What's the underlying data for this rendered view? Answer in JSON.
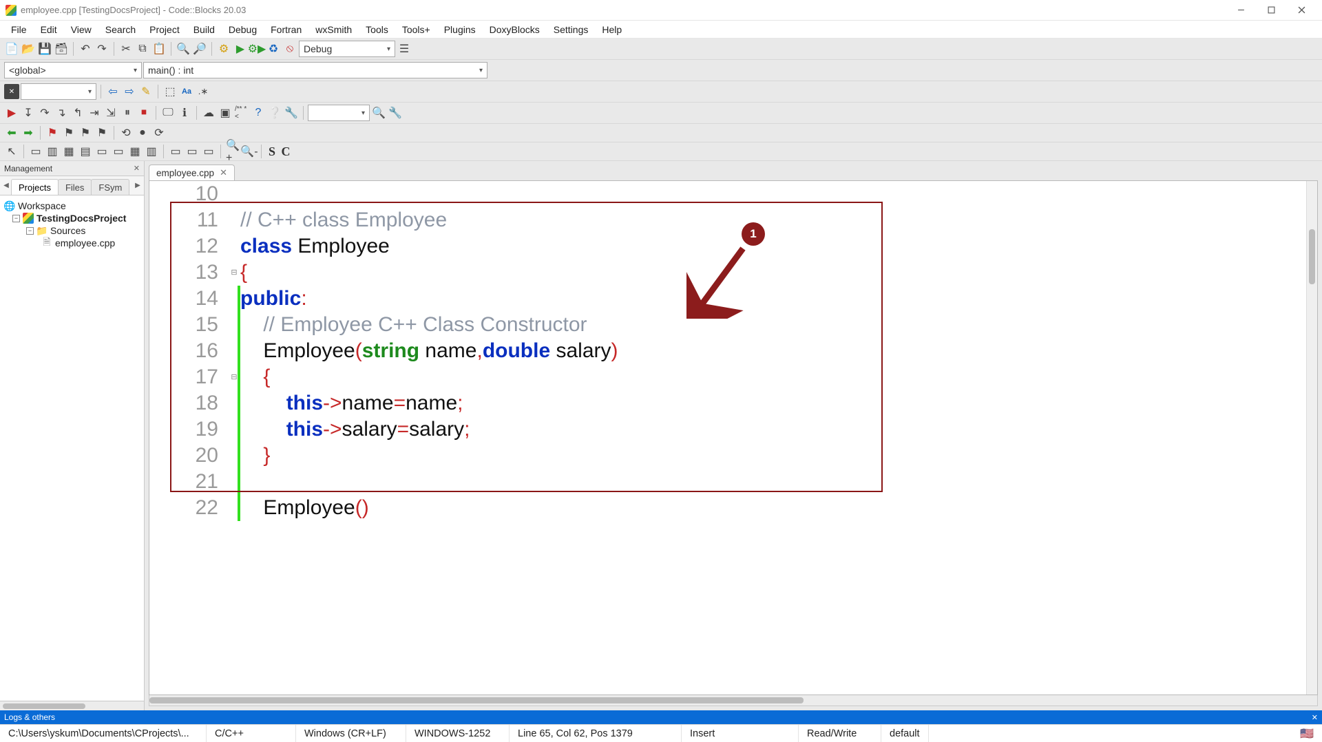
{
  "title": "employee.cpp [TestingDocsProject] - Code::Blocks 20.03",
  "menubar": [
    "File",
    "Edit",
    "View",
    "Search",
    "Project",
    "Build",
    "Debug",
    "Fortran",
    "wxSmith",
    "Tools",
    "Tools+",
    "Plugins",
    "DoxyBlocks",
    "Settings",
    "Help"
  ],
  "toolbar1": {
    "build_config": "Debug"
  },
  "scopebar": {
    "scope": "<global>",
    "func": "main() : int"
  },
  "management": {
    "title": "Management",
    "tabs": [
      "Projects",
      "Files",
      "FSym"
    ],
    "active_tab": 0,
    "tree": {
      "workspace": "Workspace",
      "project": "TestingDocsProject",
      "folder": "Sources",
      "file": "employee.cpp"
    }
  },
  "editor": {
    "tab_label": "employee.cpp",
    "lines": [
      {
        "n": 10,
        "changed": false,
        "fold": "",
        "tokens": []
      },
      {
        "n": 11,
        "changed": false,
        "fold": "",
        "tokens": [
          {
            "t": "// C++ class Employee",
            "c": "c-comment"
          }
        ]
      },
      {
        "n": 12,
        "changed": false,
        "fold": "",
        "tokens": [
          {
            "t": "class",
            "c": "c-keyword"
          },
          {
            "t": " Employee",
            "c": "c-ident"
          }
        ]
      },
      {
        "n": 13,
        "changed": false,
        "fold": "⊟",
        "tokens": [
          {
            "t": "{",
            "c": "c-punct"
          }
        ]
      },
      {
        "n": 14,
        "changed": true,
        "fold": "",
        "tokens": [
          {
            "t": "public",
            "c": "c-keyword"
          },
          {
            "t": ":",
            "c": "c-punct"
          }
        ]
      },
      {
        "n": 15,
        "changed": true,
        "fold": "",
        "tokens": [
          {
            "t": "    ",
            "c": ""
          },
          {
            "t": "// Employee C++ Class Constructor",
            "c": "c-comment"
          }
        ]
      },
      {
        "n": 16,
        "changed": true,
        "fold": "",
        "tokens": [
          {
            "t": "    Employee",
            "c": "c-ident"
          },
          {
            "t": "(",
            "c": "c-punct"
          },
          {
            "t": "string",
            "c": "c-type"
          },
          {
            "t": " name",
            "c": "c-ident"
          },
          {
            "t": ",",
            "c": "c-punct"
          },
          {
            "t": "double",
            "c": "c-keyword"
          },
          {
            "t": " salary",
            "c": "c-ident"
          },
          {
            "t": ")",
            "c": "c-punct"
          }
        ]
      },
      {
        "n": 17,
        "changed": true,
        "fold": "⊟",
        "tokens": [
          {
            "t": "    ",
            "c": ""
          },
          {
            "t": "{",
            "c": "c-punct"
          }
        ]
      },
      {
        "n": 18,
        "changed": true,
        "fold": "",
        "tokens": [
          {
            "t": "        ",
            "c": ""
          },
          {
            "t": "this",
            "c": "c-keyword"
          },
          {
            "t": "->",
            "c": "c-punct"
          },
          {
            "t": "name",
            "c": "c-ident"
          },
          {
            "t": "=",
            "c": "c-punct"
          },
          {
            "t": "name",
            "c": "c-ident"
          },
          {
            "t": ";",
            "c": "c-punct"
          }
        ]
      },
      {
        "n": 19,
        "changed": true,
        "fold": "",
        "tokens": [
          {
            "t": "        ",
            "c": ""
          },
          {
            "t": "this",
            "c": "c-keyword"
          },
          {
            "t": "->",
            "c": "c-punct"
          },
          {
            "t": "salary",
            "c": "c-ident"
          },
          {
            "t": "=",
            "c": "c-punct"
          },
          {
            "t": "salary",
            "c": "c-ident"
          },
          {
            "t": ";",
            "c": "c-punct"
          }
        ]
      },
      {
        "n": 20,
        "changed": true,
        "fold": "",
        "tokens": [
          {
            "t": "    ",
            "c": ""
          },
          {
            "t": "}",
            "c": "c-punct"
          }
        ]
      },
      {
        "n": 21,
        "changed": true,
        "fold": "",
        "tokens": []
      },
      {
        "n": 22,
        "changed": true,
        "fold": "",
        "tokens": [
          {
            "t": "    Employee",
            "c": "c-ident"
          },
          {
            "t": "()",
            "c": "c-punct"
          }
        ]
      }
    ],
    "annotation_badge": "1"
  },
  "logs_label": "Logs & others",
  "statusbar": {
    "path": "C:\\Users\\yskum\\Documents\\CProjects\\...",
    "lang": "C/C++",
    "eol": "Windows (CR+LF)",
    "enc": "WINDOWS-1252",
    "pos": "Line 65, Col 62, Pos 1379",
    "mode": "Insert",
    "rw": "Read/Write",
    "profile": "default"
  }
}
